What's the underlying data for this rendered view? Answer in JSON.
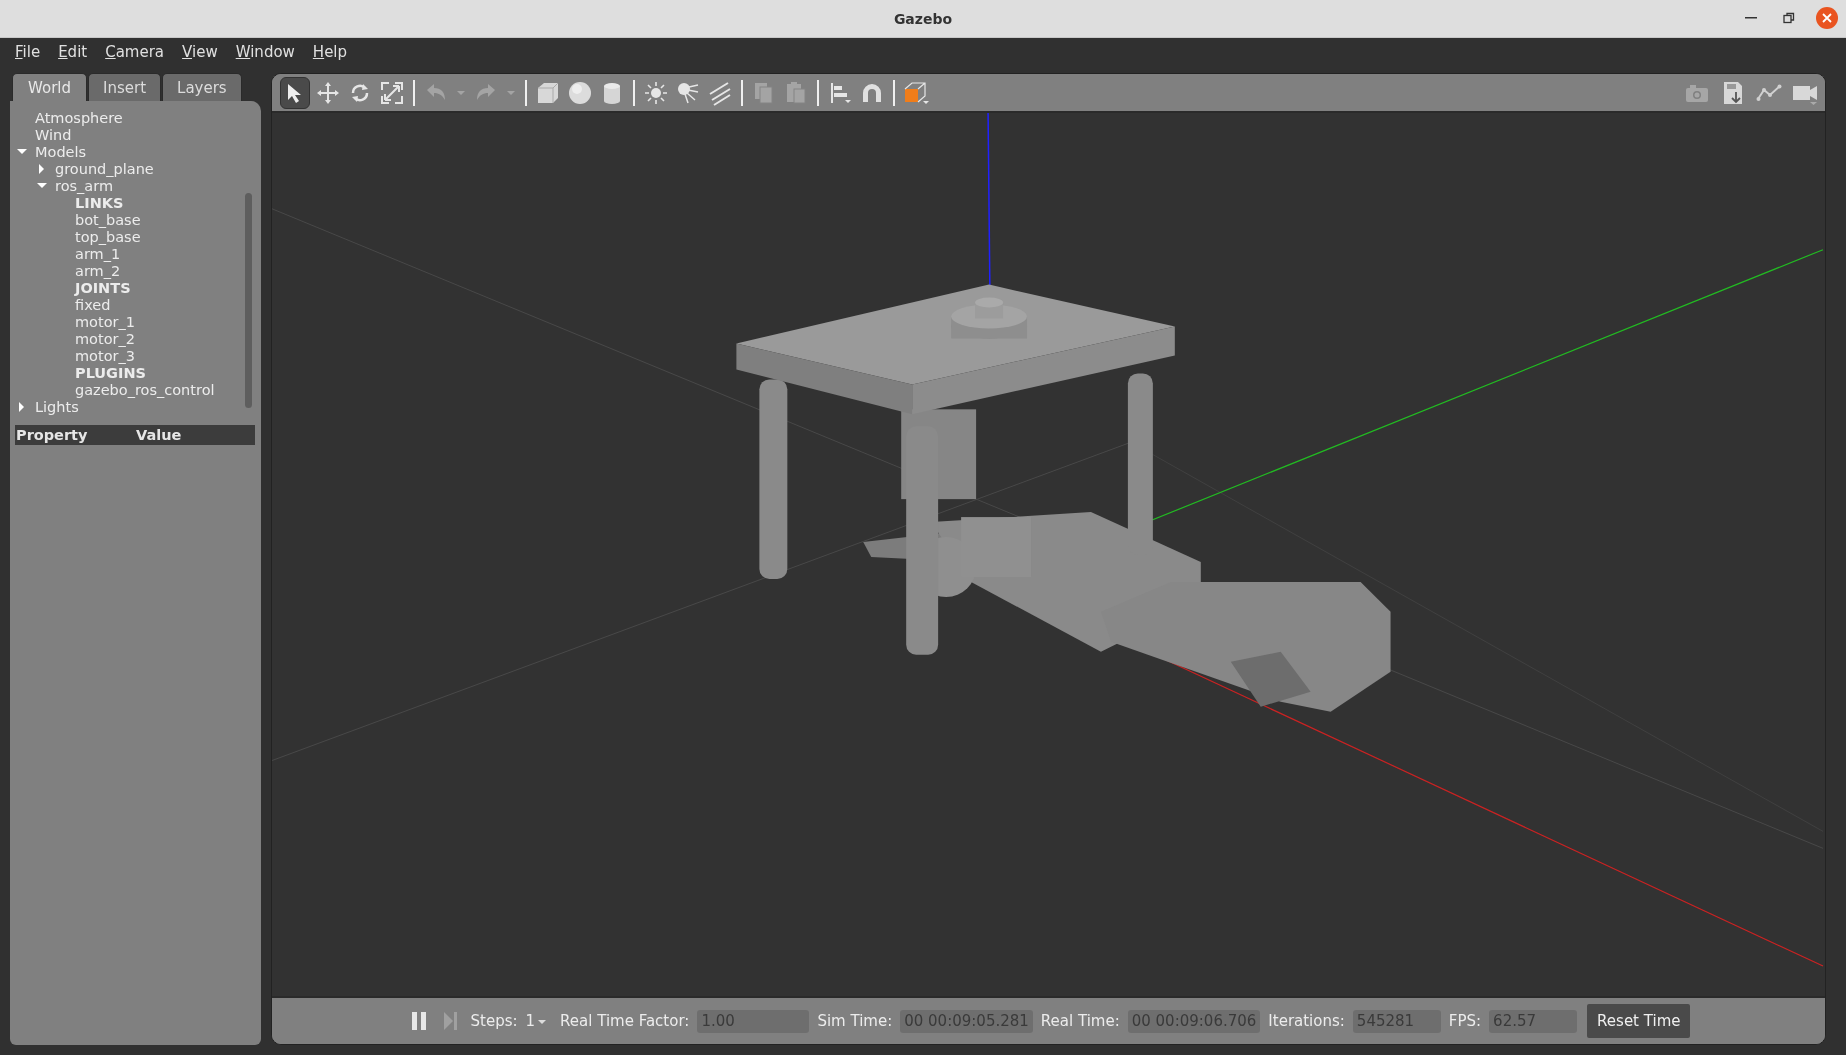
{
  "window": {
    "title": "Gazebo"
  },
  "menu": [
    "File",
    "Edit",
    "Camera",
    "View",
    "Window",
    "Help"
  ],
  "tabs": [
    {
      "label": "World",
      "selected": true
    },
    {
      "label": "Insert",
      "selected": false
    },
    {
      "label": "Layers",
      "selected": false
    }
  ],
  "tree": [
    {
      "label": "Atmosphere",
      "kind": "leaf"
    },
    {
      "label": "Wind",
      "kind": "leaf"
    },
    {
      "label": "Models",
      "kind": "node",
      "expanded": true,
      "children": [
        {
          "label": "ground_plane",
          "kind": "node",
          "expanded": false
        },
        {
          "label": "ros_arm",
          "kind": "node",
          "expanded": true,
          "children": [
            {
              "label": "LINKS",
              "kind": "heading"
            },
            {
              "label": "bot_base",
              "kind": "leaf"
            },
            {
              "label": "top_base",
              "kind": "leaf"
            },
            {
              "label": "arm_1",
              "kind": "leaf"
            },
            {
              "label": "arm_2",
              "kind": "leaf"
            },
            {
              "label": "JOINTS",
              "kind": "heading"
            },
            {
              "label": "fixed",
              "kind": "leaf"
            },
            {
              "label": "motor_1",
              "kind": "leaf"
            },
            {
              "label": "motor_2",
              "kind": "leaf"
            },
            {
              "label": "motor_3",
              "kind": "leaf"
            },
            {
              "label": "PLUGINS",
              "kind": "heading"
            },
            {
              "label": "gazebo_ros_control",
              "kind": "leaf"
            }
          ]
        }
      ]
    },
    {
      "label": "Lights",
      "kind": "node",
      "expanded": false
    }
  ],
  "properties": {
    "columns": [
      "Property",
      "Value"
    ]
  },
  "toolbar": {
    "tools": [
      {
        "kind": "select",
        "selected": true,
        "disabled": false
      },
      {
        "kind": "translate",
        "selected": false,
        "disabled": false
      },
      {
        "kind": "rotate",
        "selected": false,
        "disabled": false
      },
      {
        "kind": "scale",
        "selected": false,
        "disabled": false
      },
      {
        "kind": "separator"
      },
      {
        "kind": "undo",
        "selected": false,
        "disabled": true
      },
      {
        "kind": "caret",
        "selected": false,
        "disabled": true
      },
      {
        "kind": "redo",
        "selected": false,
        "disabled": true
      },
      {
        "kind": "caret",
        "selected": false,
        "disabled": true
      },
      {
        "kind": "separator"
      },
      {
        "kind": "box",
        "selected": false,
        "disabled": false
      },
      {
        "kind": "sphere",
        "selected": false,
        "disabled": false
      },
      {
        "kind": "cylinder",
        "selected": false,
        "disabled": false
      },
      {
        "kind": "separator"
      },
      {
        "kind": "pointlight",
        "selected": false,
        "disabled": false
      },
      {
        "kind": "spotlight",
        "selected": false,
        "disabled": false
      },
      {
        "kind": "dirlight",
        "selected": false,
        "disabled": false
      },
      {
        "kind": "separator"
      },
      {
        "kind": "copy",
        "selected": false,
        "disabled": true
      },
      {
        "kind": "paste",
        "selected": false,
        "disabled": true
      },
      {
        "kind": "separator"
      },
      {
        "kind": "align",
        "selected": false,
        "disabled": false
      },
      {
        "kind": "snap",
        "selected": false,
        "disabled": false
      },
      {
        "kind": "separator"
      },
      {
        "kind": "view",
        "selected": false,
        "disabled": false
      }
    ],
    "right_tools": [
      {
        "kind": "camera"
      },
      {
        "kind": "log"
      },
      {
        "kind": "plot"
      },
      {
        "kind": "video"
      }
    ]
  },
  "status_bar": {
    "steps_label": "Steps:",
    "steps": "1",
    "fields": [
      {
        "label": "Real Time Factor:",
        "value": "1.00"
      },
      {
        "label": "Sim Time:",
        "value": "00 00:09:05.281"
      },
      {
        "label": "Real Time:",
        "value": "00 00:09:06.706"
      },
      {
        "label": "Iterations:",
        "value": "545281"
      },
      {
        "label": "FPS:",
        "value": "62.57"
      }
    ],
    "reset_button": "Reset Time"
  }
}
